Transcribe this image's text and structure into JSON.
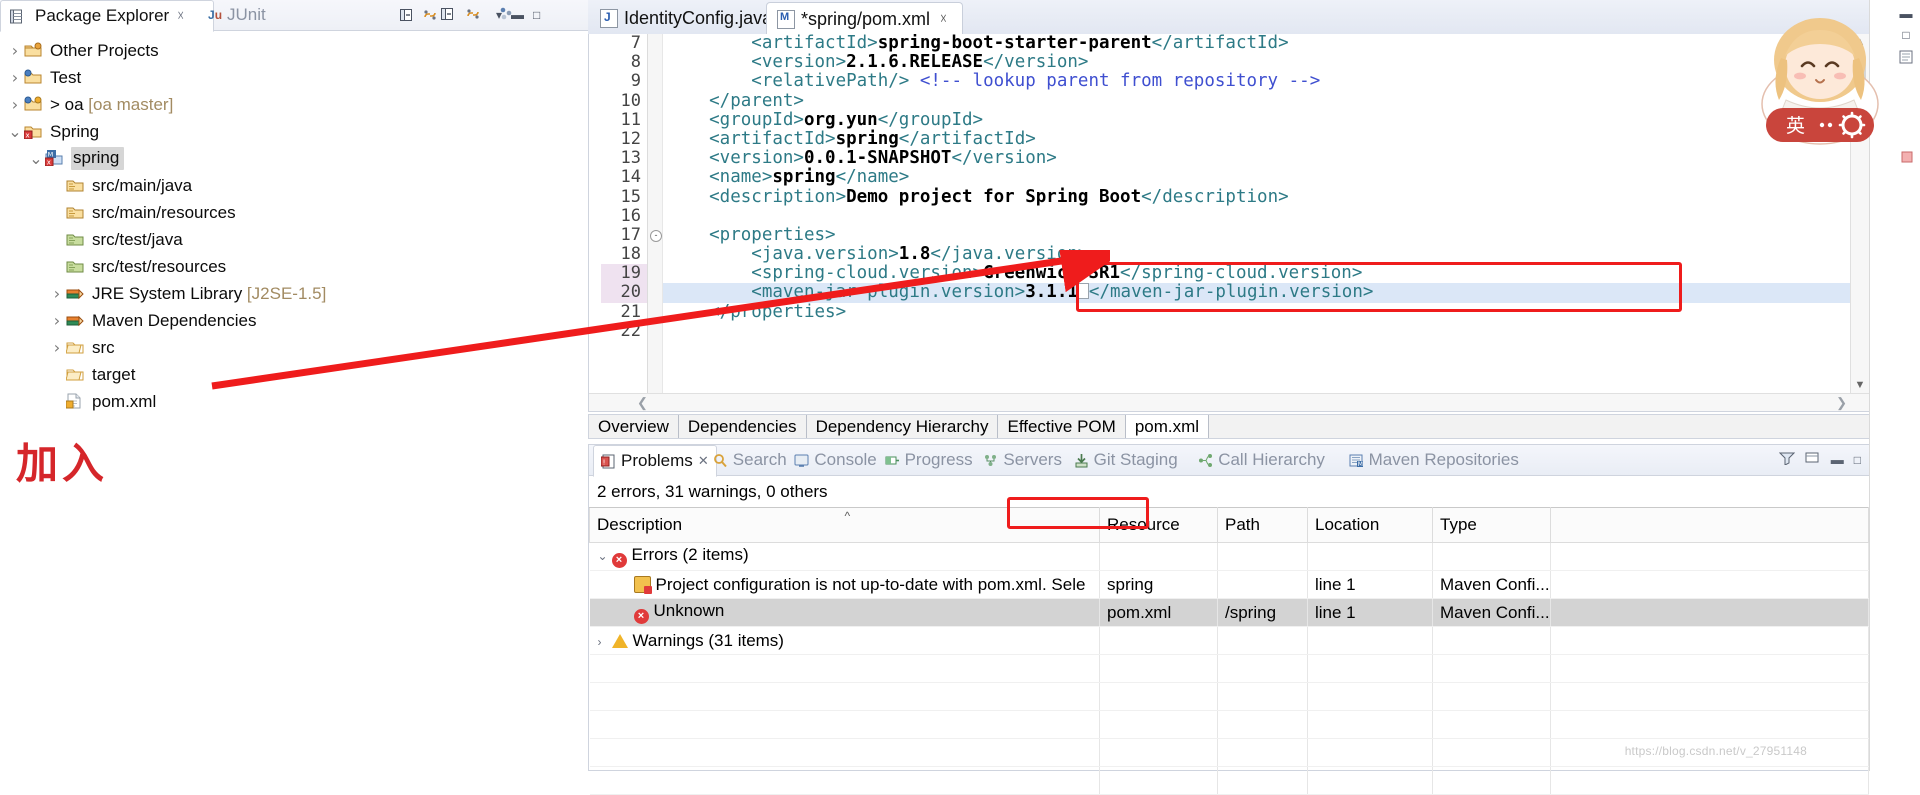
{
  "app": "Eclipse IDE",
  "package_explorer": {
    "tabs": [
      {
        "label": "Package Explorer",
        "icon": "package-explorer-icon",
        "active": true,
        "closable": true
      },
      {
        "label": "JUnit",
        "icon": "junit-icon",
        "active": false,
        "closable": false
      }
    ],
    "toolbar_icons": [
      "collapse-all-icon",
      "link-with-editor-icon",
      "view-menu-icon",
      "minimize-icon",
      "maximize-icon"
    ],
    "tree": [
      {
        "label": "Other Projects",
        "icon": "project-folder-icon",
        "twisty": ">",
        "indent": 0,
        "selected": false
      },
      {
        "label": "Test",
        "icon": "java-project-icon",
        "twisty": ">",
        "indent": 0,
        "selected": false
      },
      {
        "label": "> oa",
        "suffix": "[oa master]",
        "icon": "git-project-icon",
        "twisty": ">",
        "indent": 0,
        "selected": false
      },
      {
        "label": "Spring",
        "icon": "spring-project-icon",
        "twisty": "v",
        "indent": 0,
        "selected": false
      },
      {
        "label": "spring",
        "icon": "maven-project-icon",
        "twisty": "v",
        "indent": 1,
        "selected": true
      },
      {
        "label": "src/main/java",
        "icon": "source-folder-icon",
        "twisty": "",
        "indent": 2,
        "selected": false
      },
      {
        "label": "src/main/resources",
        "icon": "source-folder-icon",
        "twisty": "",
        "indent": 2,
        "selected": false
      },
      {
        "label": "src/test/java",
        "icon": "test-source-folder-icon",
        "twisty": "",
        "indent": 2,
        "selected": false
      },
      {
        "label": "src/test/resources",
        "icon": "test-source-folder-icon",
        "twisty": "",
        "indent": 2,
        "selected": false
      },
      {
        "label": "JRE System Library",
        "suffix": "[J2SE-1.5]",
        "icon": "library-icon",
        "twisty": ">",
        "indent": 2,
        "selected": false
      },
      {
        "label": "Maven Dependencies",
        "icon": "library-icon",
        "twisty": ">",
        "indent": 2,
        "selected": false
      },
      {
        "label": "src",
        "icon": "folder-icon",
        "twisty": ">",
        "indent": 2,
        "selected": false
      },
      {
        "label": "target",
        "icon": "folder-icon",
        "twisty": "",
        "indent": 2,
        "selected": false
      },
      {
        "label": "pom.xml",
        "icon": "xml-file-icon",
        "twisty": "",
        "indent": 2,
        "selected": false
      }
    ]
  },
  "annotations": {
    "chinese_note": "加入",
    "note_color": "#d5262a",
    "box_color": "#ef1c1c",
    "arrow_color": "#ef1c1c"
  },
  "editor": {
    "tabs": [
      {
        "label": "IdentityConfig.java",
        "icon": "java-file-icon",
        "active": false,
        "dirty": false,
        "closable": false
      },
      {
        "label": "*spring/pom.xml",
        "icon": "maven-file-icon",
        "active": true,
        "dirty": true,
        "closable": true
      }
    ],
    "code_lines": [
      {
        "no": "7",
        "fold": "",
        "highlight": false,
        "selected": false,
        "parts": [
          {
            "t": "tag",
            "s": "        <artifactId>"
          },
          {
            "t": "txt",
            "s": "spring-boot-starter-parent"
          },
          {
            "t": "tag",
            "s": "</artifactId>"
          }
        ]
      },
      {
        "no": "8",
        "fold": "",
        "highlight": false,
        "selected": false,
        "parts": [
          {
            "t": "tag",
            "s": "        <version>"
          },
          {
            "t": "txt",
            "s": "2.1.6.RELEASE"
          },
          {
            "t": "tag",
            "s": "</version>"
          }
        ]
      },
      {
        "no": "9",
        "fold": "",
        "highlight": false,
        "selected": false,
        "parts": [
          {
            "t": "tag",
            "s": "        <relativePath/>"
          },
          {
            "t": "cmt",
            "s": " <!-- lookup parent from repository -->"
          }
        ]
      },
      {
        "no": "10",
        "fold": "",
        "highlight": false,
        "selected": false,
        "parts": [
          {
            "t": "tag",
            "s": "    </parent>"
          }
        ]
      },
      {
        "no": "11",
        "fold": "",
        "highlight": false,
        "selected": false,
        "parts": [
          {
            "t": "tag",
            "s": "    <groupId>"
          },
          {
            "t": "txt",
            "s": "org.yun"
          },
          {
            "t": "tag",
            "s": "</groupId>"
          }
        ]
      },
      {
        "no": "12",
        "fold": "",
        "highlight": false,
        "selected": false,
        "parts": [
          {
            "t": "tag",
            "s": "    <artifactId>"
          },
          {
            "t": "txt",
            "s": "spring"
          },
          {
            "t": "tag",
            "s": "</artifactId>"
          }
        ]
      },
      {
        "no": "13",
        "fold": "",
        "highlight": false,
        "selected": false,
        "parts": [
          {
            "t": "tag",
            "s": "    <version>"
          },
          {
            "t": "txt",
            "s": "0.0.1-SNAPSHOT"
          },
          {
            "t": "tag",
            "s": "</version>"
          }
        ]
      },
      {
        "no": "14",
        "fold": "",
        "highlight": false,
        "selected": false,
        "parts": [
          {
            "t": "tag",
            "s": "    <name>"
          },
          {
            "t": "txt",
            "s": "spring"
          },
          {
            "t": "tag",
            "s": "</name>"
          }
        ]
      },
      {
        "no": "15",
        "fold": "",
        "highlight": false,
        "selected": false,
        "parts": [
          {
            "t": "tag",
            "s": "    <description>"
          },
          {
            "t": "txt",
            "s": "Demo project for Spring Boot"
          },
          {
            "t": "tag",
            "s": "</description>"
          }
        ]
      },
      {
        "no": "16",
        "fold": "",
        "highlight": false,
        "selected": false,
        "parts": []
      },
      {
        "no": "17",
        "fold": "-",
        "highlight": false,
        "selected": false,
        "parts": [
          {
            "t": "tag",
            "s": "    <properties>"
          }
        ]
      },
      {
        "no": "18",
        "fold": "",
        "highlight": false,
        "selected": false,
        "parts": [
          {
            "t": "tag",
            "s": "        <java.version>"
          },
          {
            "t": "txt",
            "s": "1.8"
          },
          {
            "t": "tag",
            "s": "</java.version>"
          }
        ]
      },
      {
        "no": "19",
        "fold": "",
        "highlight": true,
        "selected": false,
        "parts": [
          {
            "t": "tag",
            "s": "        <spring-cloud.version>"
          },
          {
            "t": "txt",
            "s": "Greenwich.SR1"
          },
          {
            "t": "tag",
            "s": "</spring-cloud.version>"
          }
        ]
      },
      {
        "no": "20",
        "fold": "",
        "highlight": true,
        "selected": true,
        "parts": [
          {
            "t": "tag",
            "s": "        <maven-jar-plugin.version>"
          },
          {
            "t": "txt",
            "s": "3.1.1"
          },
          {
            "t": "caret",
            "s": ""
          },
          {
            "t": "tag",
            "s": "</maven-jar-plugin.version>"
          }
        ]
      },
      {
        "no": "21",
        "fold": "",
        "highlight": false,
        "selected": false,
        "parts": [
          {
            "t": "tag",
            "s": "    </properties>"
          }
        ]
      },
      {
        "no": "22",
        "fold": "",
        "highlight": false,
        "selected": false,
        "parts": []
      }
    ],
    "form_tabs": [
      {
        "label": "Overview",
        "active": false
      },
      {
        "label": "Dependencies",
        "active": false
      },
      {
        "label": "Dependency Hierarchy",
        "active": false
      },
      {
        "label": "Effective POM",
        "active": false
      },
      {
        "label": "pom.xml",
        "active": true
      }
    ]
  },
  "problems": {
    "tabs": [
      {
        "label": "Problems",
        "icon": "problems-icon",
        "active": true,
        "closable": true
      },
      {
        "label": "Search",
        "icon": "search-icon",
        "active": false,
        "closable": false
      },
      {
        "label": "Console",
        "icon": "console-icon",
        "active": false,
        "closable": false
      },
      {
        "label": "Progress",
        "icon": "progress-icon",
        "active": false,
        "closable": false
      },
      {
        "label": "Servers",
        "icon": "servers-icon",
        "active": false,
        "closable": false
      },
      {
        "label": "Git Staging",
        "icon": "git-staging-icon",
        "active": false,
        "closable": false
      },
      {
        "label": "Call Hierarchy",
        "icon": "call-hierarchy-icon",
        "active": false,
        "closable": false
      },
      {
        "label": "Maven Repositories",
        "icon": "maven-repositories-icon",
        "active": false,
        "closable": false
      }
    ],
    "toolbar_icons": [
      "filters-icon",
      "view-menu-icon",
      "minimize-icon",
      "maximize-icon"
    ],
    "summary": "2 errors, 31 warnings, 0 others",
    "columns": [
      "Description",
      "Resource",
      "Path",
      "Location",
      "Type"
    ],
    "sorted_column": "Description",
    "sort_indicator": "^",
    "rows": [
      {
        "kind": "group",
        "caret": "v",
        "icon": "error-icon",
        "description": "Errors (2 items)",
        "resource": "",
        "path": "",
        "location": "",
        "type": "",
        "selected": false,
        "boxed": false
      },
      {
        "kind": "item",
        "caret": "",
        "icon": "maven-config-error-icon",
        "description": "Project configuration is not up-to-date with pom.xml. Sele",
        "resource": "spring",
        "path": "",
        "location": "line 1",
        "type": "Maven Confi...",
        "selected": false,
        "boxed": false
      },
      {
        "kind": "item",
        "caret": "",
        "icon": "error-icon",
        "description": "Unknown",
        "resource": "pom.xml",
        "path": "/spring",
        "location": "line 1",
        "type": "Maven Confi...",
        "selected": true,
        "boxed": true
      },
      {
        "kind": "group",
        "caret": ">",
        "icon": "warning-icon",
        "description": "Warnings (31 items)",
        "resource": "",
        "path": "",
        "location": "",
        "type": "",
        "selected": false,
        "boxed": false
      }
    ]
  },
  "watermark": "https://blog.csdn.net/v_27951148",
  "mascot": {
    "badge_left": "英",
    "badge_right": "gear-icon",
    "badge_color": "#c9453c"
  }
}
